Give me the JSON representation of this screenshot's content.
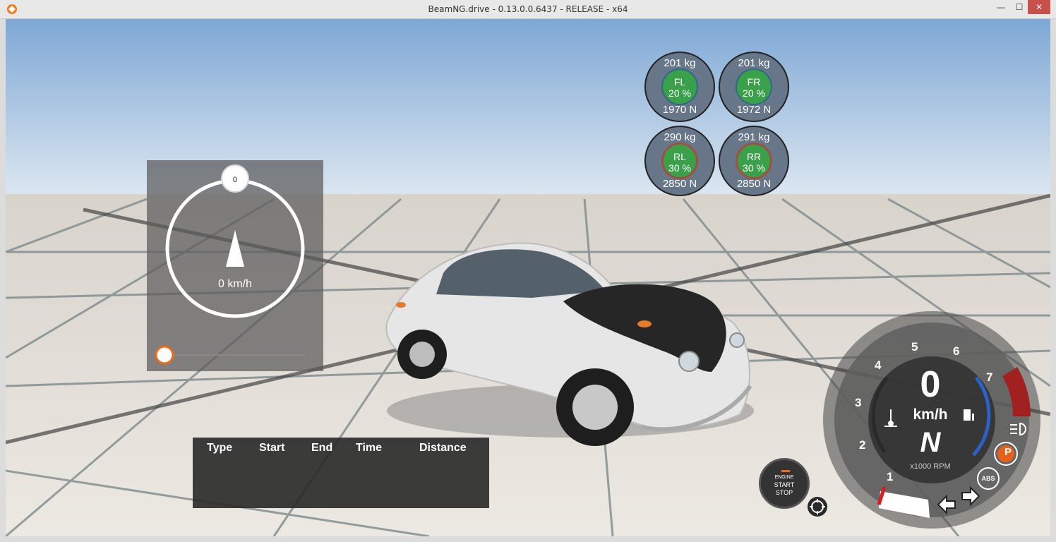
{
  "window": {
    "title": "BeamNG.drive - 0.13.0.0.6437 - RELEASE - x64",
    "minimize_label": "—",
    "maximize_label": "☐",
    "close_label": "✕"
  },
  "radar": {
    "heading": "0",
    "speed": "0 km/h"
  },
  "wheels": [
    {
      "id": "FL",
      "kg": "201 kg",
      "label": "FL",
      "pct": "20 %",
      "n": "1970 N"
    },
    {
      "id": "FR",
      "kg": "201 kg",
      "label": "FR",
      "pct": "20 %",
      "n": "1972 N"
    },
    {
      "id": "RL",
      "kg": "290 kg",
      "label": "RL",
      "pct": "30 %",
      "n": "2850 N"
    },
    {
      "id": "RR",
      "kg": "291 kg",
      "label": "RR",
      "pct": "30 %",
      "n": "2850 N"
    }
  ],
  "laptable": {
    "headers": [
      "Type",
      "Start",
      "End",
      "Time",
      "Distance"
    ]
  },
  "startstop": {
    "line1": "ENGINE",
    "line2": "START",
    "line3": "STOP"
  },
  "dash": {
    "speed": "0",
    "unit": "km/h",
    "gear": "N",
    "rpm_label": "x1000 RPM",
    "rpm_ticks": [
      "1",
      "2",
      "3",
      "4",
      "5",
      "6",
      "7"
    ],
    "rpm_value": 0.8,
    "abs_label": "ABS",
    "parking_label": "P",
    "colors": {
      "redline": "#a12020",
      "fuel_arc": "#2a62c8",
      "parking": "#e8601a",
      "needle": "#d42020"
    },
    "icons": [
      "temperature-icon",
      "fuel-icon",
      "headlight-icon",
      "parking-brake-icon",
      "abs-icon",
      "left-arrow-icon",
      "right-arrow-icon"
    ]
  }
}
